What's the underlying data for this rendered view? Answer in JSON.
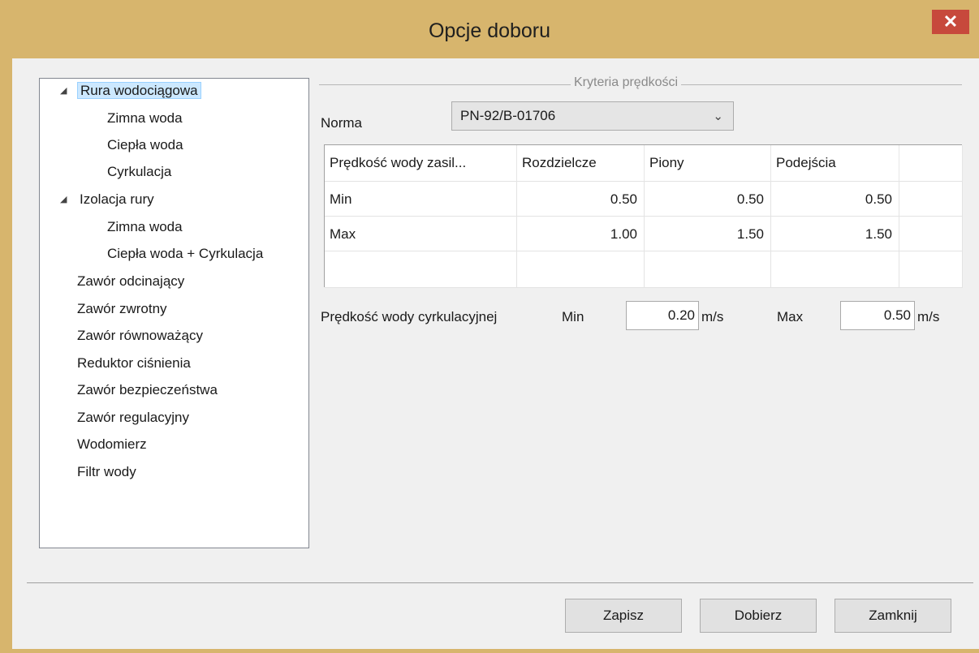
{
  "window": {
    "title": "Opcje doboru",
    "close_glyph": "✕"
  },
  "tree": {
    "items": [
      {
        "label": "Rura wodociągowa",
        "expander": "◢",
        "selected": true
      },
      {
        "label": "Zimna woda"
      },
      {
        "label": "Ciepła woda"
      },
      {
        "label": "Cyrkulacja"
      },
      {
        "label": "Izolacja rury",
        "expander": "◢"
      },
      {
        "label": "Zimna woda"
      },
      {
        "label": "Ciepła woda + Cyrkulacja"
      },
      {
        "label": "Zawór odcinający"
      },
      {
        "label": "Zawór zwrotny"
      },
      {
        "label": "Zawór równoważący"
      },
      {
        "label": "Reduktor ciśnienia"
      },
      {
        "label": "Zawór bezpieczeństwa"
      },
      {
        "label": "Zawór regulacyjny"
      },
      {
        "label": "Wodomierz"
      },
      {
        "label": "Filtr wody"
      }
    ]
  },
  "group": {
    "title": "Kryteria prędkości"
  },
  "norma": {
    "label": "Norma",
    "value": "PN-92/B-01706",
    "arrow": "⌄"
  },
  "grid": {
    "headers": [
      "Prędkość wody zasil...",
      "Rozdzielcze",
      "Piony",
      "Podejścia"
    ],
    "rows": [
      [
        "Min",
        "0.50",
        "0.50",
        "0.50"
      ],
      [
        "Max",
        "1.00",
        "1.50",
        "1.50"
      ],
      [
        "",
        "",
        "",
        ""
      ]
    ]
  },
  "circulation": {
    "label": "Prędkość wody cyrkulacyjnej",
    "min_label": "Min",
    "min_value": "0.20",
    "min_unit": "m/s",
    "max_label": "Max",
    "max_value": "0.50",
    "max_unit": "m/s"
  },
  "buttons": {
    "save": "Zapisz",
    "select": "Dobierz",
    "close": "Zamknij"
  },
  "colors": {
    "frame": "#d7b56d",
    "close": "#c7493c",
    "selection": "#cce8ff"
  }
}
